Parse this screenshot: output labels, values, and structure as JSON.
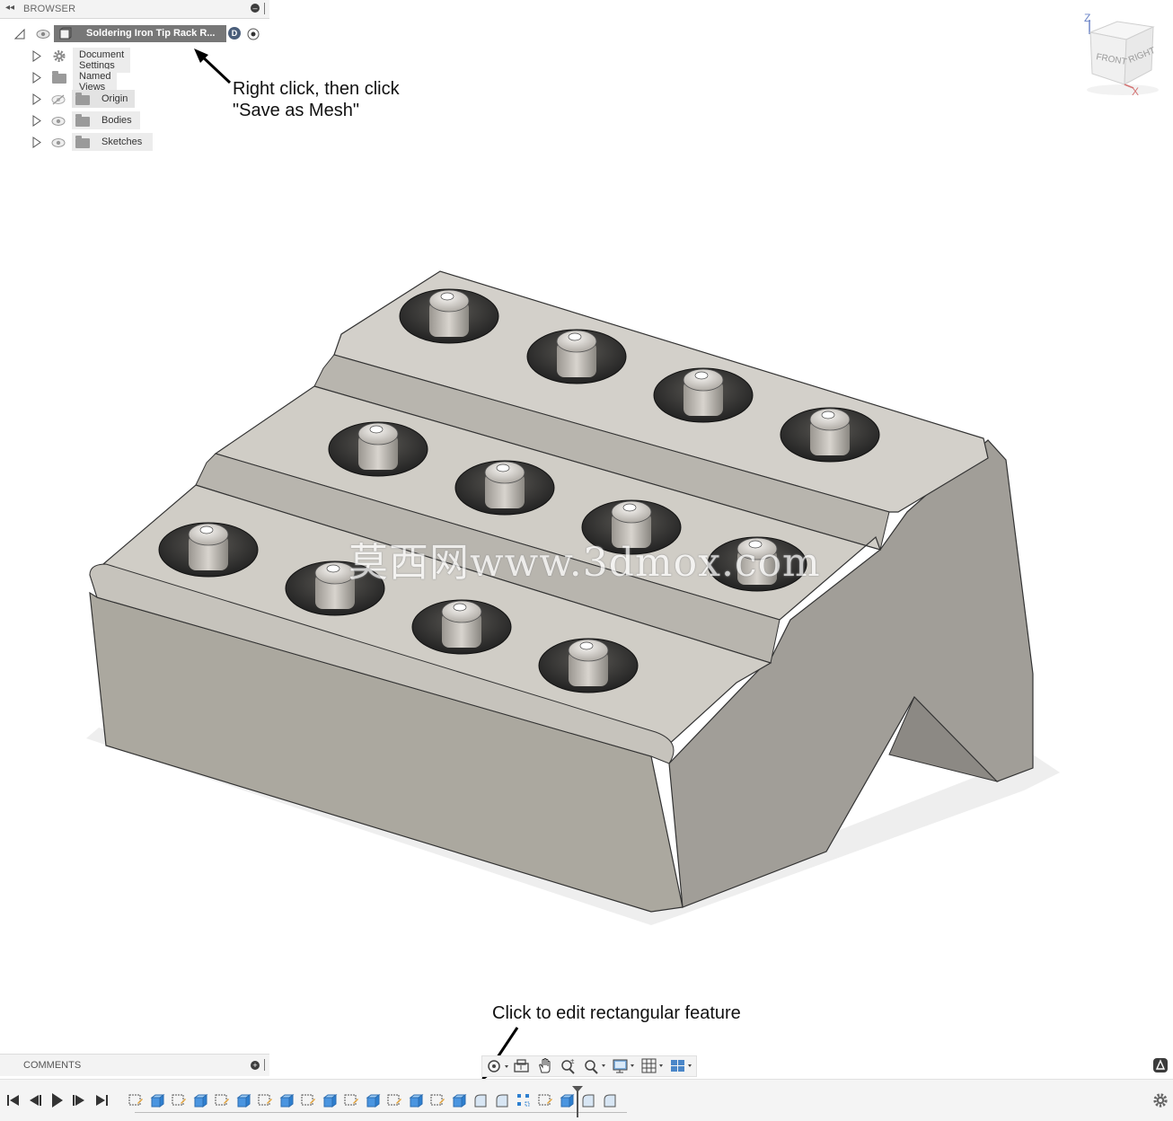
{
  "browser": {
    "title": "BROWSER",
    "root_label": "Soldering Iron Tip Rack R...",
    "items": [
      {
        "label": "Document Settings",
        "icon": "gear-icon"
      },
      {
        "label": "Named Views",
        "icon": "folder-icon"
      },
      {
        "label": "Origin",
        "icon": "folder-icon",
        "visibility": "hidden"
      },
      {
        "label": "Bodies",
        "icon": "folder-icon",
        "visibility": "visible"
      },
      {
        "label": "Sketches",
        "icon": "folder-icon",
        "visibility": "visible"
      }
    ]
  },
  "annotations": {
    "browser_line1": "Right click, then click",
    "browser_line2": "\"Save as Mesh\"",
    "timeline": "Click to edit rectangular feature"
  },
  "viewcube": {
    "z": "Z",
    "x": "X",
    "front": "FRONT",
    "right": "RIGHT"
  },
  "watermark": "莫西网www.3dmox.com",
  "comments": {
    "title": "COMMENTS"
  },
  "nav_toolbar": [
    "orbit-icon",
    "look-at-icon",
    "pan-icon",
    "zoom-icon",
    "fit-icon",
    "display-settings-icon",
    "grid-icon",
    "viewports-icon"
  ],
  "timeline": {
    "features": [
      "sketch",
      "extrude",
      "sketch",
      "extrude",
      "sketch",
      "extrude",
      "sketch",
      "extrude",
      "sketch",
      "extrude",
      "sketch",
      "extrude",
      "sketch",
      "extrude",
      "sketch",
      "extrude",
      "fillet",
      "fillet",
      "rectangular-pattern",
      "sketch",
      "extrude",
      "fillet",
      "fillet"
    ]
  },
  "colors": {
    "model_top": "#d2cfc9",
    "model_side": "#9d9a94",
    "model_front": "#aaa79f",
    "panel_bg": "#f3f3f3",
    "accent_blue": "#2d7fd0"
  }
}
